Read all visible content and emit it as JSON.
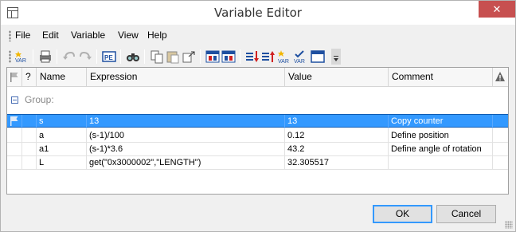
{
  "window": {
    "title": "Variable Editor",
    "close_glyph": "✕"
  },
  "menu": {
    "items": [
      "File",
      "Edit",
      "Variable",
      "View",
      "Help"
    ]
  },
  "toolbar": {
    "icons": [
      "new-variable-icon",
      "print-icon",
      "undo-icon",
      "redo-icon",
      "properties-icon",
      "find-icon",
      "copy-icon",
      "paste-icon",
      "paste-special-icon",
      "import-icon",
      "export-icon",
      "move-down-icon",
      "move-up-icon",
      "new-var-icon",
      "check-var-icon",
      "window-icon"
    ]
  },
  "grid": {
    "columns": [
      "",
      "?",
      "Name",
      "Expression",
      "Value",
      "Comment",
      ""
    ],
    "group_label": "Group:",
    "rows": [
      {
        "name": "s",
        "expression": "13",
        "value": "13",
        "comment": "Copy counter",
        "selected": true,
        "flag": true
      },
      {
        "name": "a",
        "expression": "(s-1)/100",
        "value": "0.12",
        "comment": "Define position",
        "selected": false,
        "flag": false
      },
      {
        "name": "a1",
        "expression": "(s-1)*3.6",
        "value": "43.2",
        "comment": "Define angle of rotation",
        "selected": false,
        "flag": false
      },
      {
        "name": "L",
        "expression": "get(\"0x3000002\",\"LENGTH\")",
        "value": "32.305517",
        "comment": "",
        "selected": false,
        "flag": false
      }
    ]
  },
  "buttons": {
    "ok": "OK",
    "cancel": "Cancel"
  },
  "colors": {
    "selection": "#3399ff",
    "close": "#c75050"
  }
}
